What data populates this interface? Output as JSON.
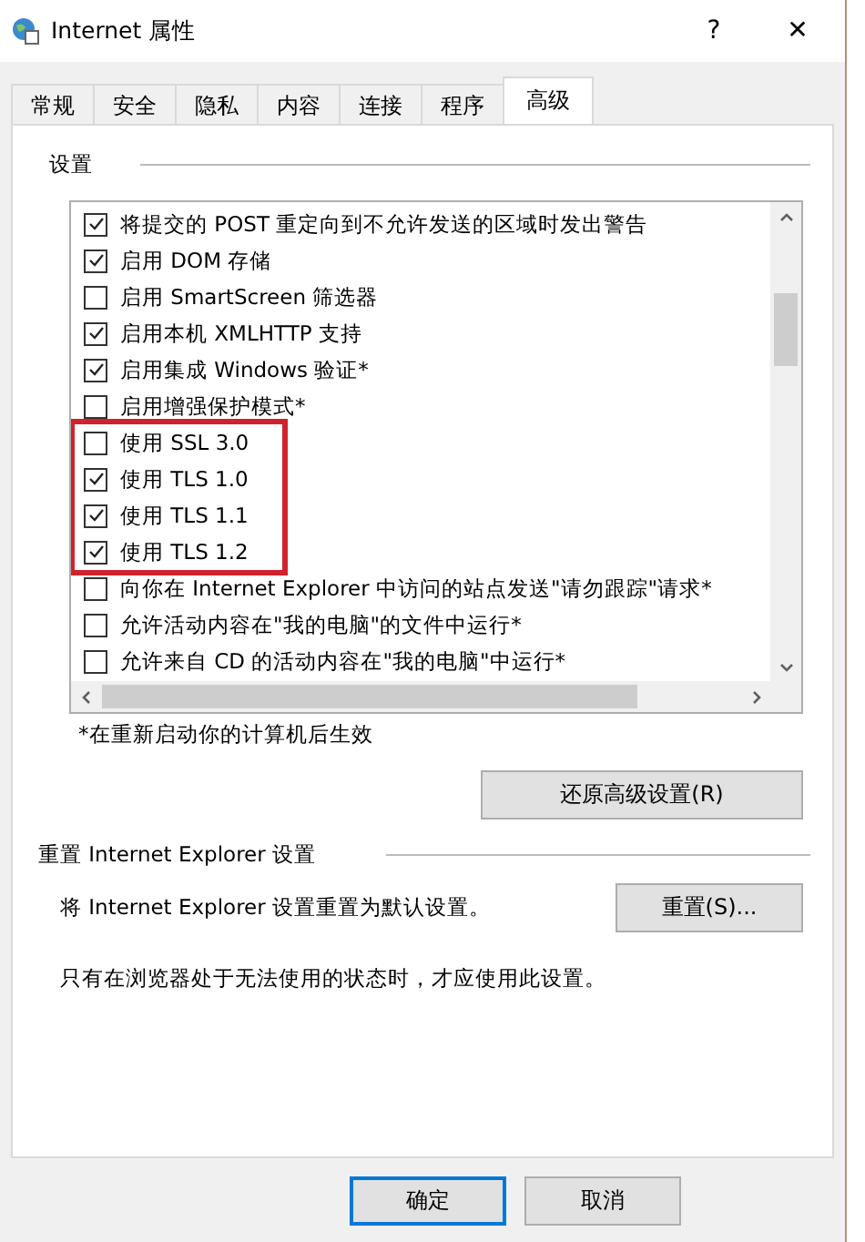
{
  "window": {
    "title": "Internet 属性",
    "help": "?",
    "close": "✕"
  },
  "tabs": [
    {
      "label": "常规",
      "selected": false
    },
    {
      "label": "安全",
      "selected": false
    },
    {
      "label": "隐私",
      "selected": false
    },
    {
      "label": "内容",
      "selected": false
    },
    {
      "label": "连接",
      "selected": false
    },
    {
      "label": "程序",
      "selected": false
    },
    {
      "label": "高级",
      "selected": true
    }
  ],
  "settings": {
    "title": "设置",
    "options": [
      {
        "label": "将提交的 POST 重定向到不允许发送的区域时发出警告",
        "checked": true,
        "highlighted": false
      },
      {
        "label": "启用 DOM 存储",
        "checked": true,
        "highlighted": false
      },
      {
        "label": "启用 SmartScreen 筛选器",
        "checked": false,
        "highlighted": false
      },
      {
        "label": "启用本机 XMLHTTP 支持",
        "checked": true,
        "highlighted": false
      },
      {
        "label": "启用集成 Windows 验证*",
        "checked": true,
        "highlighted": false
      },
      {
        "label": "启用增强保护模式*",
        "checked": false,
        "highlighted": false
      },
      {
        "label": "使用 SSL 3.0",
        "checked": false,
        "highlighted": true
      },
      {
        "label": "使用 TLS 1.0",
        "checked": true,
        "highlighted": true
      },
      {
        "label": "使用 TLS 1.1",
        "checked": true,
        "highlighted": true
      },
      {
        "label": "使用 TLS 1.2",
        "checked": true,
        "highlighted": true
      },
      {
        "label": "向你在 Internet Explorer 中访问的站点发送\"请勿跟踪\"请求*",
        "checked": false,
        "highlighted": false
      },
      {
        "label": "允许活动内容在\"我的电脑\"的文件中运行*",
        "checked": false,
        "highlighted": false
      },
      {
        "label": "允许来自 CD 的活动内容在\"我的电脑\"中运行*",
        "checked": false,
        "highlighted": false
      }
    ],
    "footnote": "*在重新启动你的计算机后生效",
    "restore_button": "还原高级设置(R)"
  },
  "reset": {
    "title": "重置 Internet Explorer 设置",
    "description": "将 Internet Explorer 设置重置为默认设置。",
    "button": "重置(S)...",
    "note": "只有在浏览器处于无法使用的状态时，才应使用此设置。"
  },
  "buttons": [
    {
      "label": "确定",
      "default": true
    },
    {
      "label": "取消",
      "default": false
    }
  ]
}
